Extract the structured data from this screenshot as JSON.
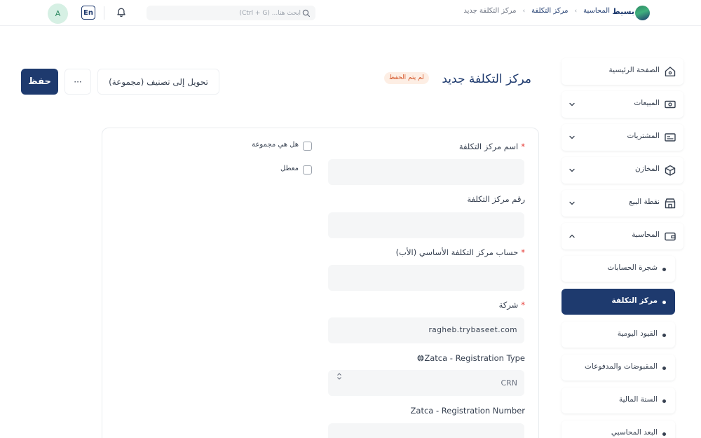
{
  "navbar": {
    "avatar_letter": "A",
    "language": "En",
    "search_placeholder": "ابحث هنا... (Ctrl + G)",
    "breadcrumbs": [
      {
        "label": "المحاسبة"
      },
      {
        "label": "مركز التكلفة"
      },
      {
        "label": "مركز التكلفة جديد"
      }
    ],
    "brand_name": "بسيط"
  },
  "header": {
    "title": "مركز التكلفة جديد",
    "status": "لم يتم الحفظ",
    "convert_label": "تحويل إلى تصنيف (مجموعة)",
    "more_label": "···",
    "save_label": "حفظ"
  },
  "sidebar": {
    "items": [
      {
        "label": "الصفحة الرئيسية",
        "icon": "home-icon"
      },
      {
        "label": "المبيعات",
        "icon": "cash-icon"
      },
      {
        "label": "المشتريات",
        "icon": "card-icon"
      },
      {
        "label": "المخازن",
        "icon": "box-icon"
      },
      {
        "label": "نقطة البيع",
        "icon": "store-icon"
      },
      {
        "label": "المحاسبة",
        "icon": "wallet-icon"
      }
    ],
    "subitems": [
      {
        "label": "شجرة الحسابات"
      },
      {
        "label": "مركز التكلفة"
      },
      {
        "label": "القيود اليومية"
      },
      {
        "label": "المقبوضات والمدفوعات"
      },
      {
        "label": "السنة المالية"
      },
      {
        "label": "البعد المحاسبي"
      }
    ]
  },
  "form": {
    "cost_center_name": {
      "label": "اسم مركز التكلفة",
      "value": ""
    },
    "cost_center_number": {
      "label": "رقم مركز التكلفة",
      "value": ""
    },
    "parent_account": {
      "label": "حساب مركز التكلفة الأساسي (الأب)",
      "value": ""
    },
    "company": {
      "label": "شركة",
      "value": "ragheb.trybaseet.com"
    },
    "registration_type": {
      "label": "Zatca - Registration Type",
      "value": "CRN"
    },
    "registration_number": {
      "label": "Zatca - Registration Number",
      "value": ""
    },
    "is_group": {
      "label": "هل هي مجموعة"
    },
    "disabled": {
      "label": "معطل"
    },
    "required_mark": "*"
  },
  "colors": {
    "primary": "#1e3a6e",
    "badge_bg": "#fdeee4",
    "badge_text": "#d4572a",
    "input_bg": "#f5f6f7"
  }
}
